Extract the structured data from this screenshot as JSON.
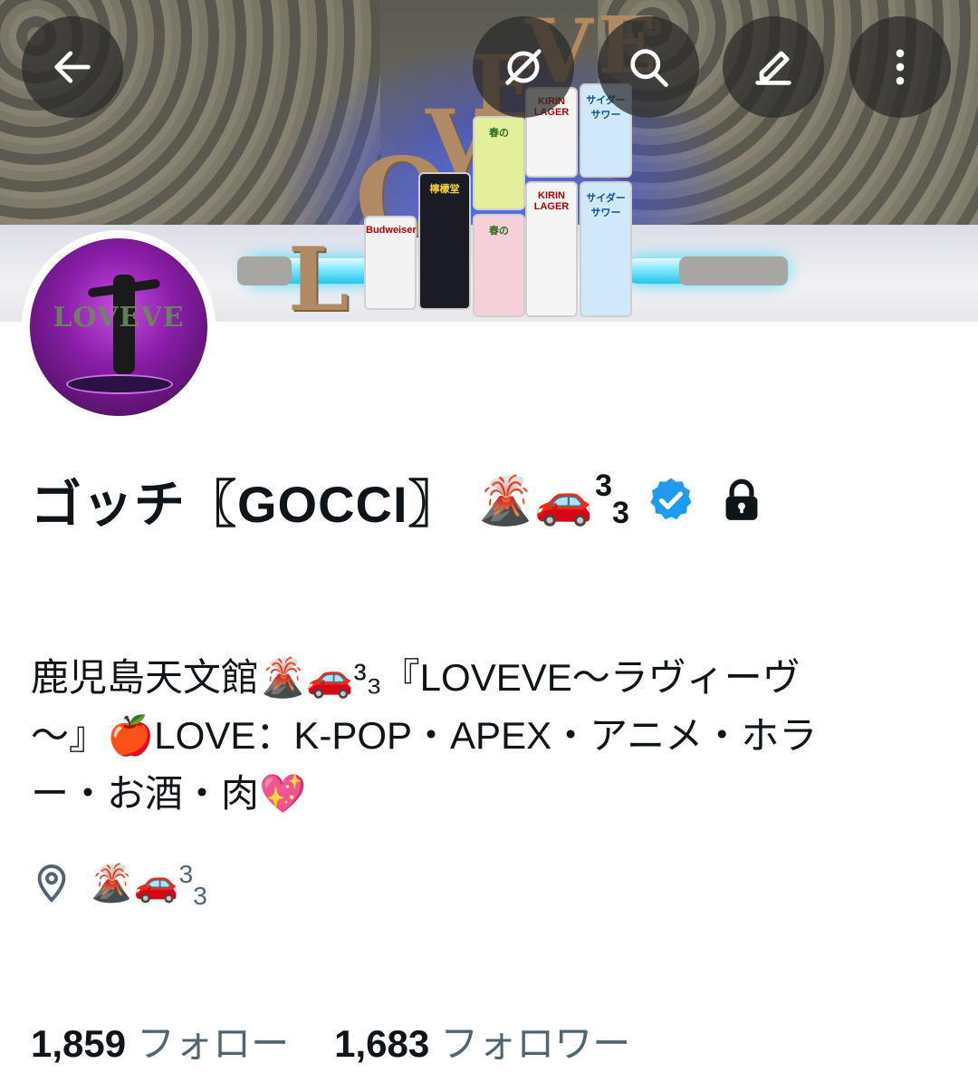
{
  "header": {
    "back_icon": "arrow-left-icon",
    "hide_icon": "eye-slash-icon",
    "search_icon": "search-icon",
    "edit_icon": "pencil-icon",
    "more_icon": "more-vertical-icon"
  },
  "banner": {
    "letters": [
      "L",
      "O",
      "V",
      "E",
      "V",
      "E"
    ],
    "cans": [
      "Budweiser",
      "檸檬堂",
      "春の",
      "KIRIN LAGER",
      "サイダーサワー",
      "春の",
      "KIRIN LAGER",
      "サイダーサワー"
    ]
  },
  "avatar": {
    "text": "LOVEVE"
  },
  "profile": {
    "name": "ゴッチ〖GOCCI〗",
    "name_emoji": "🌋🚗",
    "name_sup": "3",
    "name_sub": "3",
    "verified_icon": "verified-badge-icon",
    "protected_icon": "lock-icon",
    "bio_line1": "鹿児島天文館🌋🚗³₃『LOVEVE〜ラヴィーヴ",
    "bio_line2": "〜』🍎LOVE：K-POP・APEX・アニメ・ホラ",
    "bio_line3": "ー・お酒・肉💖",
    "location_icon": "location-pin-icon",
    "location_emoji": "🌋🚗",
    "location_sup": "3",
    "location_sub": "3"
  },
  "stats": {
    "following_count": "1,859",
    "following_label": "フォロー",
    "followers_count": "1,683",
    "followers_label": "フォロワー"
  },
  "colors": {
    "text_primary": "#0f1419",
    "text_secondary": "#536471",
    "verified_blue": "#1d9bf0",
    "nav_button_bg": "#282828"
  }
}
